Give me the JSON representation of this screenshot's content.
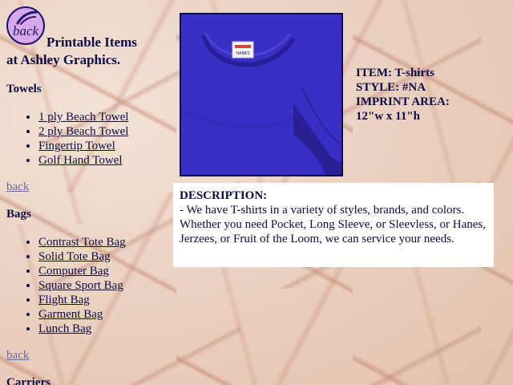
{
  "nav": {
    "logo_text": "back",
    "title_line1": "Printable Items",
    "title_line2": "at Ashley Graphics.",
    "back_label": "back",
    "sections": [
      {
        "heading": "Towels",
        "items": [
          "1 ply Beach Towel",
          "2 ply Beach Towel",
          "Fingertip Towel",
          "Golf Hand Towel"
        ]
      },
      {
        "heading": "Bags",
        "items": [
          "Contrast Tote Bag",
          "Solid Tote Bag",
          "Computer Bag",
          "Square Sport Bag",
          "Flight Bag",
          "Garment Bag",
          "Lunch Bag"
        ]
      },
      {
        "heading": "Carriers",
        "items": []
      }
    ]
  },
  "product": {
    "item": "ITEM: T-shirts",
    "style": "STYLE: #NA",
    "imprint_label": "IMPRINT AREA:",
    "imprint_value": "12\"w x 11\"h",
    "shirt_color": "#3a2fc4",
    "tag_text": "HANES"
  },
  "description": {
    "label": "DESCRIPTION:",
    "text": "- We have T-shirts in a variety of styles, brands, and colors. Whether you need Pocket, Long Sleeve, or Sleevless, or Hanes, Jerzees, or Fruit of the Loom, we can service your needs."
  },
  "colors": {
    "text": "#0b0b45",
    "link_visited": "#6a6aa8",
    "logo_bg": "#d7a9e6",
    "marble_bg": "#ecd3c3"
  }
}
